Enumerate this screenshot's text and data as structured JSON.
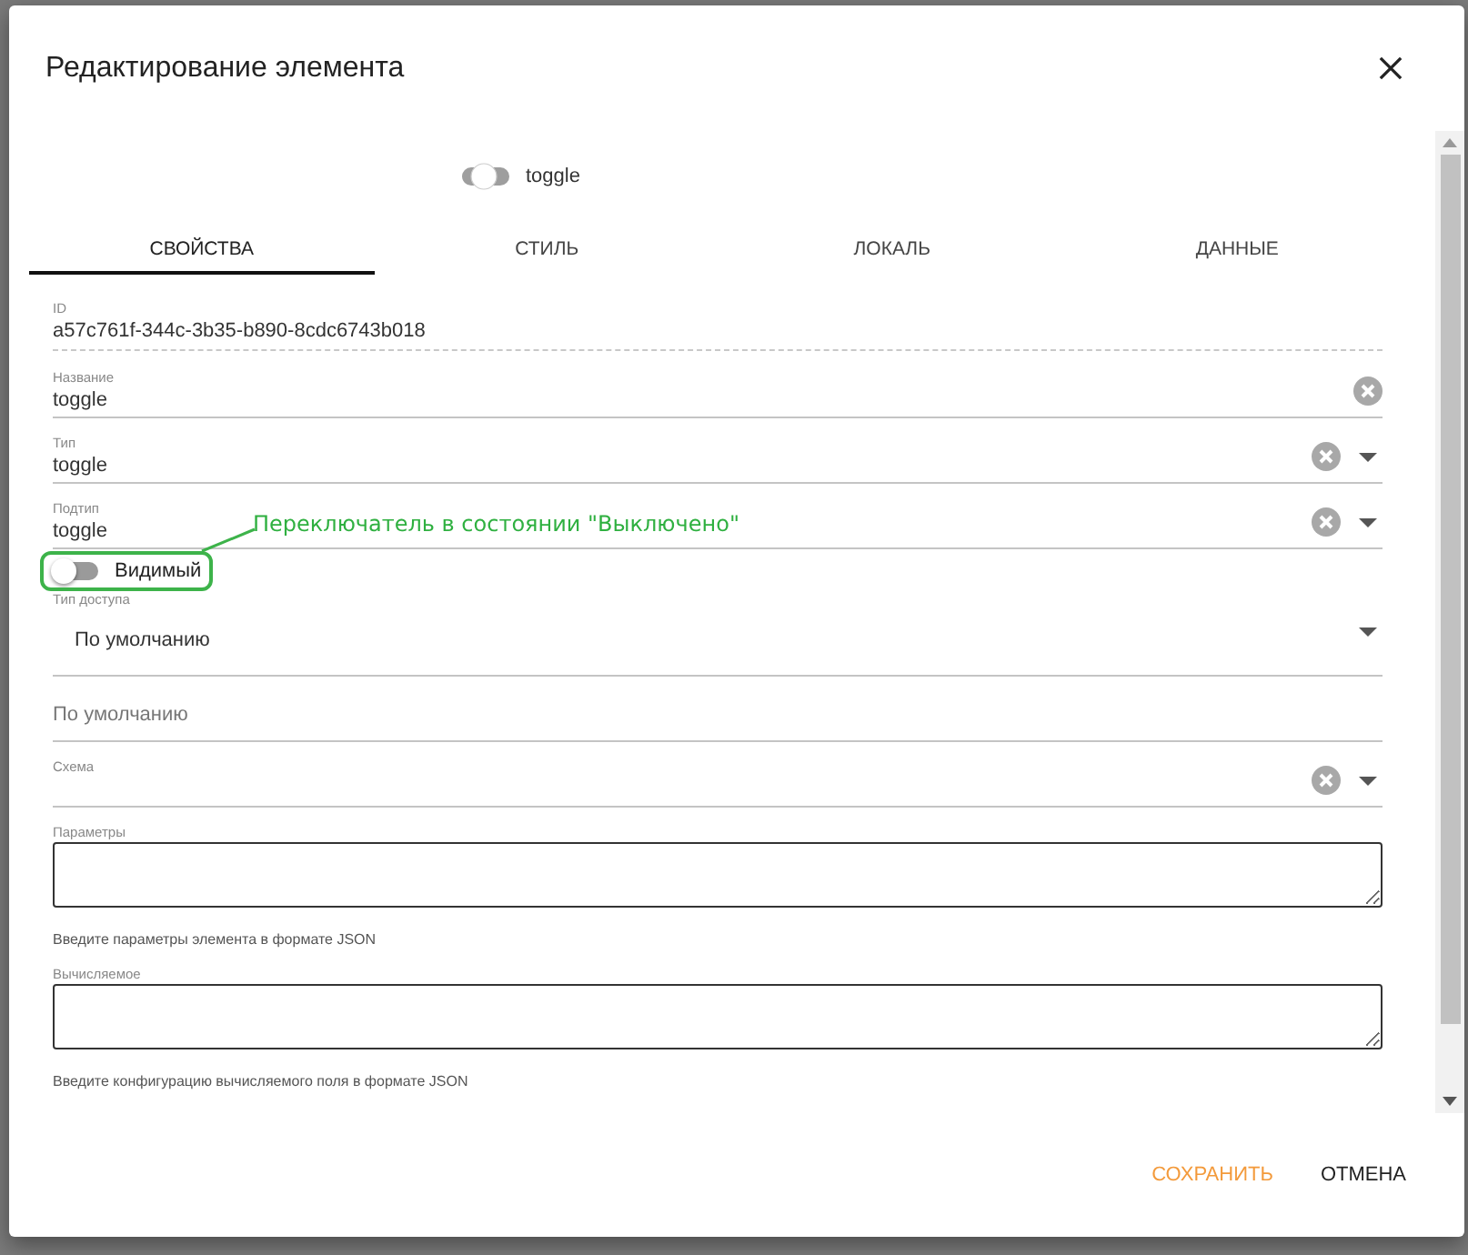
{
  "dialog": {
    "title": "Редактирование элемента"
  },
  "component": {
    "name": "toggle"
  },
  "tabs": [
    {
      "label": "СВОЙСТВА",
      "selected": true
    },
    {
      "label": "СТИЛЬ",
      "selected": false
    },
    {
      "label": "ЛОКАЛЬ",
      "selected": false
    },
    {
      "label": "ДАННЫЕ",
      "selected": false
    }
  ],
  "fields": [
    {
      "kind": "readonly",
      "label": "ID",
      "value": "a57c761f-344c-3b35-b890-8cdc6743b018"
    },
    {
      "kind": "text",
      "label": "Название",
      "value": "toggle",
      "clearable": true,
      "dropdown": false
    },
    {
      "kind": "text",
      "label": "Тип",
      "value": "toggle",
      "clearable": true,
      "dropdown": true
    },
    {
      "kind": "text",
      "label": "Подтип",
      "value": "toggle",
      "clearable": true,
      "dropdown": true
    },
    {
      "kind": "switch",
      "label": "Видимый",
      "on": false
    },
    {
      "kind": "select",
      "label": "Тип доступа",
      "value": "По умолчанию",
      "clearable": false,
      "dropdown": true
    },
    {
      "kind": "placeholder",
      "placeholder": "По умолчанию"
    },
    {
      "kind": "text",
      "label": "Схема",
      "clearable": true,
      "dropdown": true
    },
    {
      "kind": "textarea",
      "label": "Параметры",
      "hint": "Введите параметры элемента в формате JSON"
    },
    {
      "kind": "textarea",
      "label": "Вычисляемое",
      "hint": "Введите конфигурацию вычисляемого поля в формате JSON"
    }
  ],
  "annotation": {
    "text": "Переключатель в состоянии \"Выключено\""
  },
  "buttons": [
    {
      "label": "СОХРАНИТЬ",
      "kind": "primary"
    },
    {
      "label": "ОТМЕНА",
      "kind": "secondary"
    }
  ]
}
